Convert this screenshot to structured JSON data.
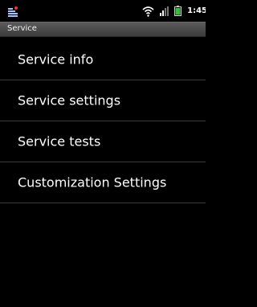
{
  "status_bar": {
    "time": "1:45",
    "icons": [
      "notification-icon",
      "wifi-icon",
      "signal-icon",
      "battery-icon"
    ]
  },
  "title_bar": {
    "title": "Service"
  },
  "menu": {
    "items": [
      {
        "label": "Service info"
      },
      {
        "label": "Service settings"
      },
      {
        "label": "Service tests"
      },
      {
        "label": "Customization Settings"
      }
    ]
  },
  "colors": {
    "background": "#000000",
    "text": "#ffffff",
    "divider": "#3a3a3a",
    "title_bar": "#4a4a4a",
    "battery_fill": "#35c23a"
  }
}
